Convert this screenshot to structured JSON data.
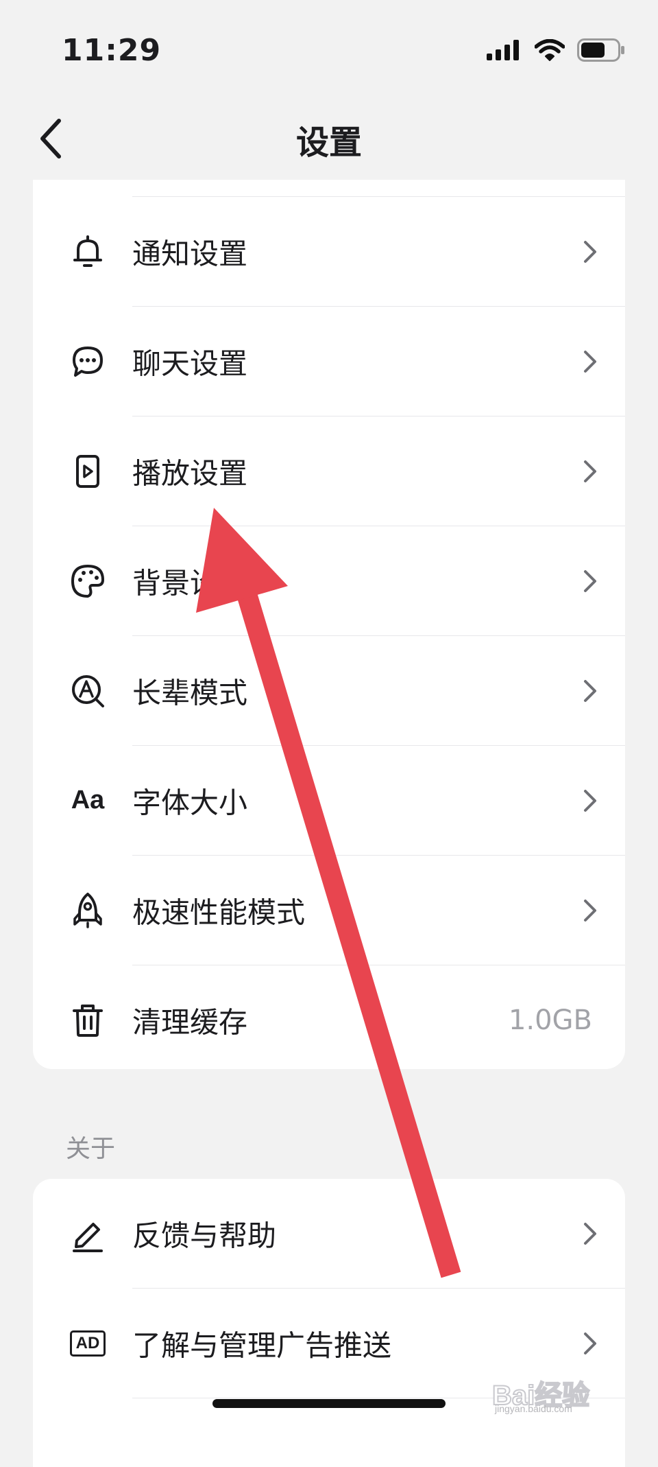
{
  "status_bar": {
    "time": "11:29"
  },
  "nav": {
    "title": "设置"
  },
  "settings": [
    {
      "label": "通知设置",
      "icon": "bell-icon"
    },
    {
      "label": "聊天设置",
      "icon": "chat-bubble-icon"
    },
    {
      "label": "播放设置",
      "icon": "play-icon"
    },
    {
      "label": "背景设置",
      "icon": "palette-icon"
    },
    {
      "label": "长辈模式",
      "icon": "elder-mode-icon"
    },
    {
      "label": "字体大小",
      "icon": "font-size-icon",
      "icon_text": "Aa"
    },
    {
      "label": "极速性能模式",
      "icon": "rocket-icon"
    },
    {
      "label": "清理缓存",
      "icon": "trash-icon",
      "value": "1.0GB"
    }
  ],
  "about": {
    "title": "关于",
    "items": [
      {
        "label": "反馈与帮助",
        "icon": "pencil-icon"
      },
      {
        "label": "了解与管理广告推送",
        "icon": "ad-icon",
        "icon_text": "AD"
      }
    ]
  },
  "watermark": {
    "text": "Bai经验",
    "domain": "jingyan.baidu.com"
  },
  "colors": {
    "background": "#f2f2f2",
    "card": "#ffffff",
    "arrow": "#e8454f",
    "secondary_text": "#a2a3a8"
  }
}
